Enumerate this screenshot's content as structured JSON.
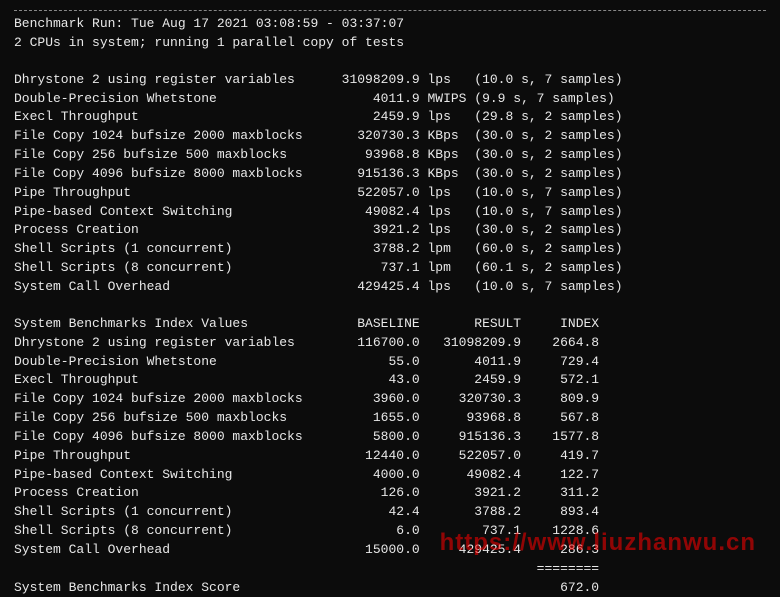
{
  "header": {
    "line1": "Benchmark Run: Tue Aug 17 2021 03:08:59 - 03:37:07",
    "line2": "2 CPUs in system; running 1 parallel copy of tests"
  },
  "tests": [
    {
      "name": "Dhrystone 2 using register variables",
      "value": "31098209.9",
      "unit": "lps",
      "timing": "(10.0 s, 7 samples)"
    },
    {
      "name": "Double-Precision Whetstone",
      "value": "4011.9",
      "unit": "MWIPS",
      "timing": "(9.9 s, 7 samples)"
    },
    {
      "name": "Execl Throughput",
      "value": "2459.9",
      "unit": "lps",
      "timing": "(29.8 s, 2 samples)"
    },
    {
      "name": "File Copy 1024 bufsize 2000 maxblocks",
      "value": "320730.3",
      "unit": "KBps",
      "timing": "(30.0 s, 2 samples)"
    },
    {
      "name": "File Copy 256 bufsize 500 maxblocks",
      "value": "93968.8",
      "unit": "KBps",
      "timing": "(30.0 s, 2 samples)"
    },
    {
      "name": "File Copy 4096 bufsize 8000 maxblocks",
      "value": "915136.3",
      "unit": "KBps",
      "timing": "(30.0 s, 2 samples)"
    },
    {
      "name": "Pipe Throughput",
      "value": "522057.0",
      "unit": "lps",
      "timing": "(10.0 s, 7 samples)"
    },
    {
      "name": "Pipe-based Context Switching",
      "value": "49082.4",
      "unit": "lps",
      "timing": "(10.0 s, 7 samples)"
    },
    {
      "name": "Process Creation",
      "value": "3921.2",
      "unit": "lps",
      "timing": "(30.0 s, 2 samples)"
    },
    {
      "name": "Shell Scripts (1 concurrent)",
      "value": "3788.2",
      "unit": "lpm",
      "timing": "(60.0 s, 2 samples)"
    },
    {
      "name": "Shell Scripts (8 concurrent)",
      "value": "737.1",
      "unit": "lpm",
      "timing": "(60.1 s, 2 samples)"
    },
    {
      "name": "System Call Overhead",
      "value": "429425.4",
      "unit": "lps",
      "timing": "(10.0 s, 7 samples)"
    }
  ],
  "index_header": {
    "col1": "System Benchmarks Index Values",
    "col2": "BASELINE",
    "col3": "RESULT",
    "col4": "INDEX"
  },
  "index_rows": [
    {
      "name": "Dhrystone 2 using register variables",
      "baseline": "116700.0",
      "result": "31098209.9",
      "index": "2664.8"
    },
    {
      "name": "Double-Precision Whetstone",
      "baseline": "55.0",
      "result": "4011.9",
      "index": "729.4"
    },
    {
      "name": "Execl Throughput",
      "baseline": "43.0",
      "result": "2459.9",
      "index": "572.1"
    },
    {
      "name": "File Copy 1024 bufsize 2000 maxblocks",
      "baseline": "3960.0",
      "result": "320730.3",
      "index": "809.9"
    },
    {
      "name": "File Copy 256 bufsize 500 maxblocks",
      "baseline": "1655.0",
      "result": "93968.8",
      "index": "567.8"
    },
    {
      "name": "File Copy 4096 bufsize 8000 maxblocks",
      "baseline": "5800.0",
      "result": "915136.3",
      "index": "1577.8"
    },
    {
      "name": "Pipe Throughput",
      "baseline": "12440.0",
      "result": "522057.0",
      "index": "419.7"
    },
    {
      "name": "Pipe-based Context Switching",
      "baseline": "4000.0",
      "result": "49082.4",
      "index": "122.7"
    },
    {
      "name": "Process Creation",
      "baseline": "126.0",
      "result": "3921.2",
      "index": "311.2"
    },
    {
      "name": "Shell Scripts (1 concurrent)",
      "baseline": "42.4",
      "result": "3788.2",
      "index": "893.4"
    },
    {
      "name": "Shell Scripts (8 concurrent)",
      "baseline": "6.0",
      "result": "737.1",
      "index": "1228.6"
    },
    {
      "name": "System Call Overhead",
      "baseline": "15000.0",
      "result": "429425.4",
      "index": "286.3"
    }
  ],
  "equals_line": "                                                                   ========",
  "score": {
    "label": "System Benchmarks Index Score",
    "value": "672.0"
  },
  "watermark": "https://www.liuzhanwu.cn"
}
